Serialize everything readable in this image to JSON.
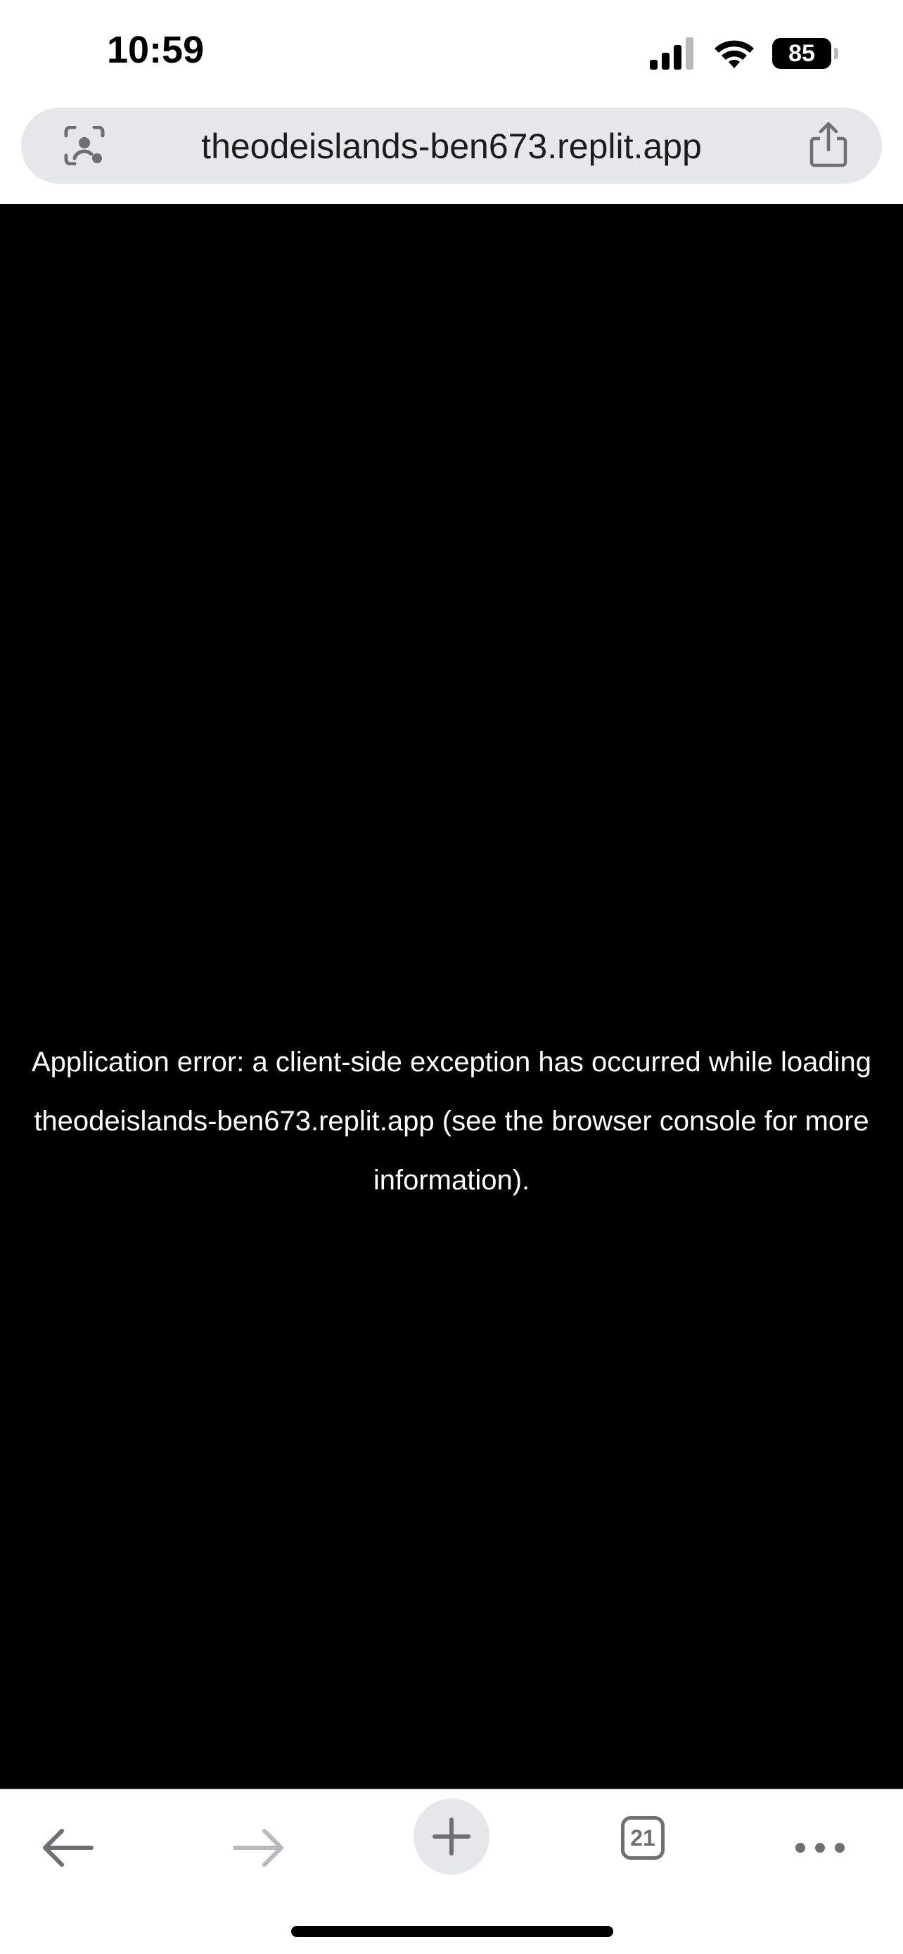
{
  "status_bar": {
    "time": "10:59",
    "battery_level": "85",
    "icons": [
      "signal-icon",
      "wifi-icon",
      "battery-icon"
    ]
  },
  "address_bar": {
    "url": "theodeislands-ben673.replit.app",
    "left_icon": "lens-icon",
    "right_icon": "share-icon"
  },
  "content": {
    "background": "#000000",
    "error_message": "Application error: a client-side exception has occurred while loading theodeislands-ben673.replit.app (see the browser console for more information)."
  },
  "toolbar": {
    "back_icon": "back-arrow-icon",
    "forward_icon": "forward-arrow-icon",
    "new_tab_icon": "plus-icon",
    "tab_count": "21",
    "more_icon": "more-icon"
  },
  "colors": {
    "address_bar_bg": "#e5e7ea",
    "toolbar_icon": "#6e6e73",
    "disabled_icon": "#b8b8bd"
  }
}
